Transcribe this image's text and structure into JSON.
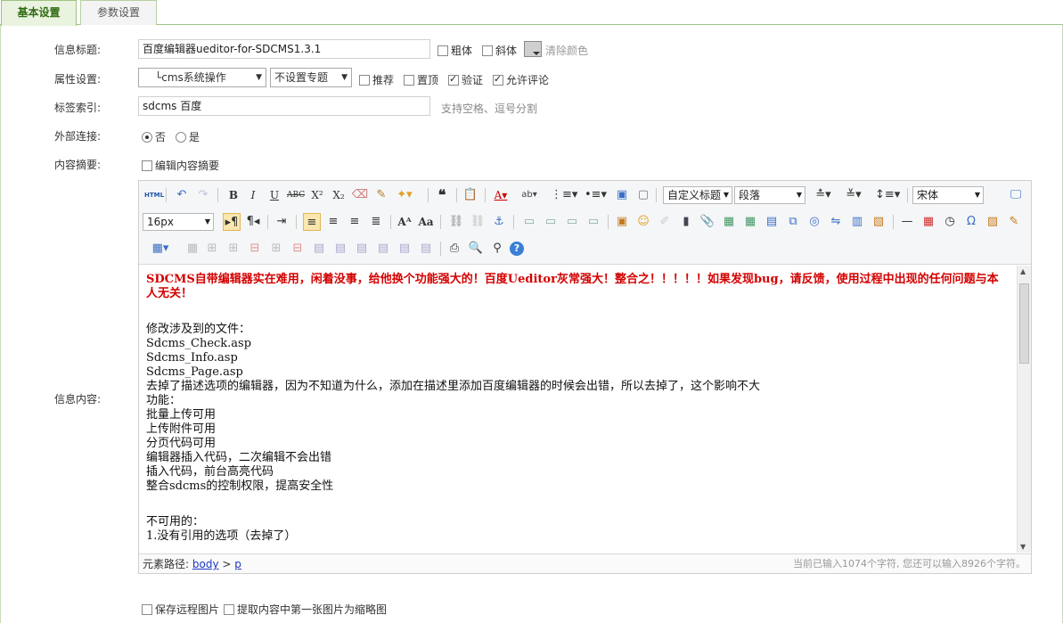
{
  "tabs": [
    "基本设置",
    "参数设置"
  ],
  "form": {
    "title_label": "信息标题:",
    "title_value": "百度编辑器ueditor-for-SDCMS1.3.1",
    "bold_label": "粗体",
    "italic_label": "斜体",
    "clear_color_label": "清除颜色",
    "attr_label": "属性设置:",
    "category_value": "└cms系统操作",
    "topic_value": "不设置专题",
    "recommend_label": "推荐",
    "top_label": "置顶",
    "verify_label": "验证",
    "comment_label": "允许评论",
    "tags_label": "标签索引:",
    "tags_value": "sdcms 百度",
    "tags_hint": "支持空格、逗号分割",
    "external_label": "外部连接:",
    "no_label": "否",
    "yes_label": "是",
    "summary_label": "内容摘要:",
    "edit_summary_label": "编辑内容摘要",
    "content_label": "信息内容:",
    "save_remote_label": "保存远程图片",
    "thumb_label": "提取内容中第一张图片为缩略图"
  },
  "toolbar": {
    "html_label": "HTML",
    "heading_select": "自定义标题",
    "paragraph_select": "段落",
    "font_select": "宋体",
    "size_select": "16px"
  },
  "content": {
    "red_text": "SDCMS自带编辑器实在难用，闲着没事，给他换个功能强大的！百度Ueditor灰常强大！整合之！！！！！如果发现bug，请反馈，使用过程中出现的任何问题与本人无关！",
    "files_header": "修改涉及到的文件：",
    "files": [
      "Sdcms_Check.asp",
      "Sdcms_Info.asp",
      "Sdcms_Page.asp"
    ],
    "removed_note": "去掉了描述选项的编辑器，因为不知道为什么，添加在描述里添加百度编辑器的时候会出错，所以去掉了，这个影响不大",
    "features_header": "功能：",
    "features": [
      "批量上传可用",
      "上传附件可用",
      "分页代码可用",
      "编辑器插入代码，二次编辑不会出错",
      "插入代码，前台高亮代码",
      "整合sdcms的控制权限，提高安全性"
    ],
    "unavailable_header": "不可用的：",
    "unavailable_1": "1.没有引用的选项（去掉了）"
  },
  "status": {
    "path_label": "元素路径:",
    "path_body": "body",
    "path_sep": ">",
    "path_p": "p",
    "count": "当前已输入1074个字符, 您还可以输入8926个字符。"
  }
}
